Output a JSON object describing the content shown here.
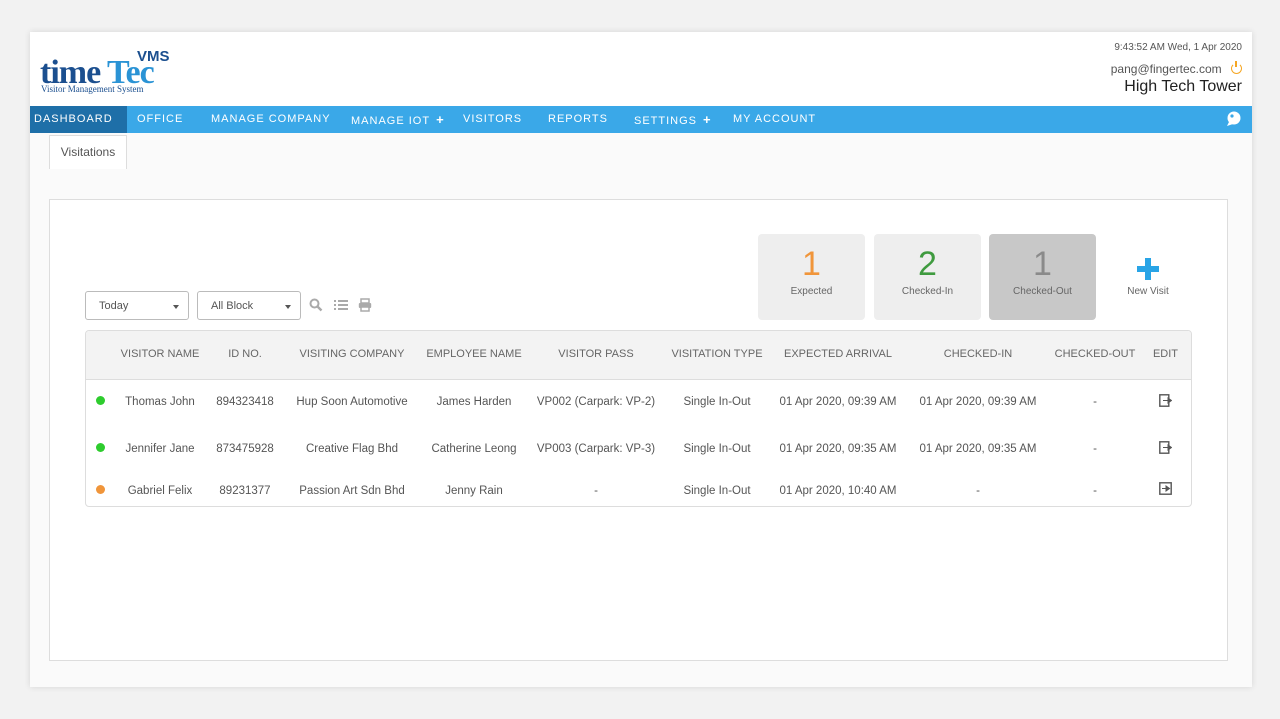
{
  "header": {
    "logo_time": "time",
    "logo_tec": "Tec",
    "logo_vms": "VMS",
    "logo_subtitle": "Visitor Management System",
    "datetime": "9:43:52 AM Wed, 1 Apr 2020",
    "user_email": "pang@fingertec.com",
    "site_name": "High Tech Tower"
  },
  "nav": {
    "items": [
      {
        "label": "DASHBOARD",
        "active": true
      },
      {
        "label": "OFFICE"
      },
      {
        "label": "MANAGE COMPANY"
      },
      {
        "label": "MANAGE IOT",
        "plus": "+"
      },
      {
        "label": "VISITORS"
      },
      {
        "label": "REPORTS"
      },
      {
        "label": "SETTINGS",
        "plus": "+"
      },
      {
        "label": "MY ACCOUNT"
      }
    ]
  },
  "tabs": [
    {
      "label": "Visitations"
    }
  ],
  "stats": {
    "expected": {
      "count": "1",
      "label": "Expected",
      "color": "#f0953a"
    },
    "checked_in": {
      "count": "2",
      "label": "Checked-In",
      "color": "#3f9b3f"
    },
    "checked_out": {
      "count": "1",
      "label": "Checked-Out",
      "color": "#8a8a8a"
    },
    "new_visit_label": "New Visit"
  },
  "filters": {
    "date": "Today",
    "block": "All Block"
  },
  "table": {
    "columns": [
      "VISITOR NAME",
      "ID NO.",
      "VISITING COMPANY",
      "EMPLOYEE NAME",
      "VISITOR PASS",
      "VISITATION TYPE",
      "EXPECTED ARRIVAL",
      "CHECKED-IN",
      "CHECKED-OUT",
      "EDIT"
    ],
    "rows": [
      {
        "status_color": "#2ecc2e",
        "visitor_name": "Thomas John",
        "id_no": "894323418",
        "company": "Hup Soon Automotive",
        "employee": "James Harden",
        "pass": "VP002 (Carpark: VP-2)",
        "type": "Single In-Out",
        "expected": "01 Apr 2020, 09:39 AM",
        "checked_in": "01 Apr 2020, 09:39 AM",
        "checked_out": "-"
      },
      {
        "status_color": "#2ecc2e",
        "visitor_name": "Jennifer Jane",
        "id_no": "873475928",
        "company": "Creative Flag Bhd",
        "employee": "Catherine Leong",
        "pass": "VP003 (Carpark: VP-3)",
        "type": "Single In-Out",
        "expected": "01 Apr 2020, 09:35 AM",
        "checked_in": "01 Apr 2020, 09:35 AM",
        "checked_out": "-"
      },
      {
        "status_color": "#f0953a",
        "visitor_name": "Gabriel Felix",
        "id_no": "89231377",
        "company": "Passion Art Sdn Bhd",
        "employee": "Jenny Rain",
        "pass": "-",
        "type": "Single In-Out",
        "expected": "01 Apr 2020, 10:40 AM",
        "checked_in": "-",
        "checked_out": "-"
      }
    ]
  }
}
